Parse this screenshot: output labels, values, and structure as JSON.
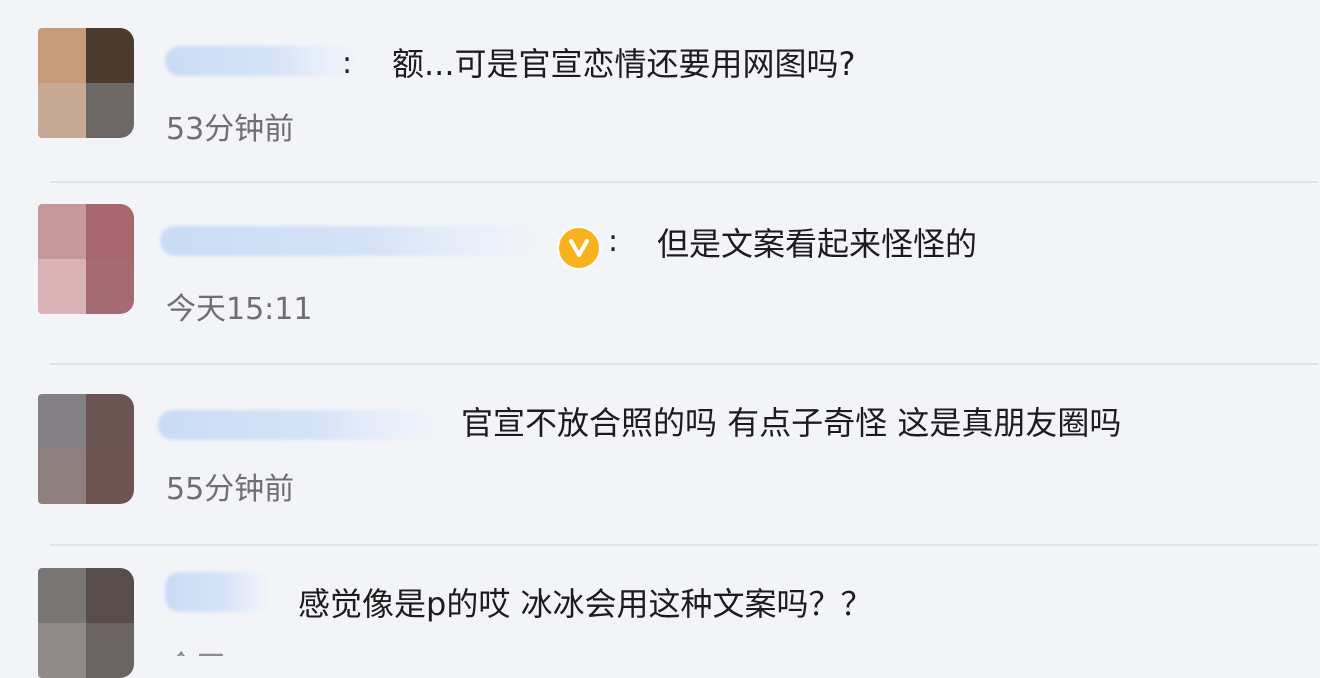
{
  "comments": [
    {
      "text": "额...可是官宣恋情还要用网图吗?",
      "time": "53分钟前",
      "colon": ":",
      "verified": false,
      "avatar_colors": [
        "#c89b78",
        "#4d3a2e",
        "#c8a995",
        "#6d6765"
      ]
    },
    {
      "text": "但是文案看起来怪怪的",
      "time": "今天15:11",
      "colon": ":",
      "verified": true,
      "avatar_colors": [
        "#c7989b",
        "#a6676d",
        "#d9b3b6",
        "#a66a73"
      ]
    },
    {
      "text": "官宣不放合照的吗 有点子奇怪 这是真朋友圈吗",
      "time": "55分钟前",
      "verified": false,
      "avatar_colors": [
        "#858083",
        "#6b5653",
        "#8f7f7e",
        "#6e5350"
      ]
    },
    {
      "text": "感觉像是p的哎 冰冰会用这种文案吗？？",
      "time": "今天",
      "verified": false,
      "avatar_colors": [
        "#7b7676",
        "#574e4c",
        "#908a88",
        "#6c6462"
      ]
    }
  ],
  "colors": {
    "background": "#f3f4f8",
    "divider": "#e2e3e8",
    "verified_badge": "#f7b21e",
    "text": "#1c1c1c",
    "time": "#6f6f72"
  },
  "icons": {
    "verified": "verified-badge-icon"
  }
}
